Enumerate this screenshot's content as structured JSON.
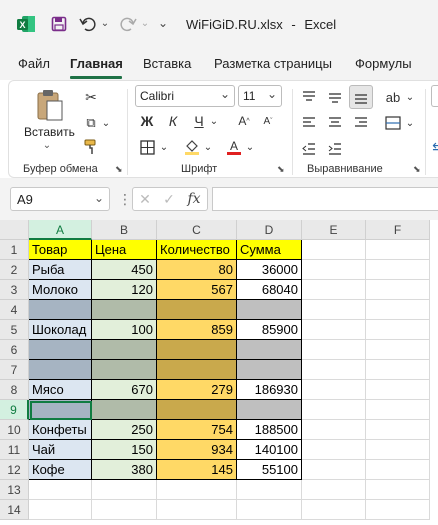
{
  "titlebar": {
    "file_name": "WiFiGiD.RU.xlsx",
    "separator": "-",
    "app_name": "Excel"
  },
  "menu": {
    "items": [
      "Файл",
      "Главная",
      "Вставка",
      "Разметка страницы",
      "Формулы"
    ],
    "active": "Главная"
  },
  "ribbon": {
    "clipboard": {
      "paste_label": "Вставить",
      "group_label": "Буфер обмена"
    },
    "font": {
      "font_name": "Calibri",
      "font_size": "11",
      "bold": "Ж",
      "italic": "К",
      "underline": "Ч",
      "group_label": "Шрифт"
    },
    "alignment": {
      "group_label": "Выравнивание"
    }
  },
  "formula_bar": {
    "cell_ref": "A9",
    "fx": "fx",
    "formula": ""
  },
  "sheet": {
    "columns": [
      "A",
      "B",
      "C",
      "D",
      "E",
      "F"
    ],
    "selected_column": "A",
    "selected_row": "9",
    "rows": [
      {
        "num": "1",
        "cells": [
          "Товар",
          "Цена",
          "Количество",
          "Сумма",
          "",
          ""
        ]
      },
      {
        "num": "2",
        "cells": [
          "Рыба",
          "450",
          "80",
          "36000",
          "",
          ""
        ]
      },
      {
        "num": "3",
        "cells": [
          "Молоко",
          "120",
          "567",
          "68040",
          "",
          ""
        ]
      },
      {
        "num": "4",
        "cells": [
          "",
          "",
          "",
          "",
          "",
          ""
        ]
      },
      {
        "num": "5",
        "cells": [
          "Шоколад",
          "100",
          "859",
          "85900",
          "",
          ""
        ]
      },
      {
        "num": "6",
        "cells": [
          "",
          "",
          "",
          "",
          "",
          ""
        ]
      },
      {
        "num": "7",
        "cells": [
          "",
          "",
          "",
          "",
          "",
          ""
        ]
      },
      {
        "num": "8",
        "cells": [
          "Мясо",
          "670",
          "279",
          "186930",
          "",
          ""
        ]
      },
      {
        "num": "9",
        "cells": [
          "",
          "",
          "",
          "",
          "",
          ""
        ]
      },
      {
        "num": "10",
        "cells": [
          "Конфеты",
          "250",
          "754",
          "188500",
          "",
          ""
        ]
      },
      {
        "num": "11",
        "cells": [
          "Чай",
          "150",
          "934",
          "140100",
          "",
          ""
        ]
      },
      {
        "num": "12",
        "cells": [
          "Кофе",
          "380",
          "145",
          "55100",
          "",
          ""
        ]
      },
      {
        "num": "13",
        "cells": [
          "",
          "",
          "",
          "",
          "",
          ""
        ]
      },
      {
        "num": "14",
        "cells": [
          "",
          "",
          "",
          "",
          "",
          ""
        ]
      }
    ],
    "colors": {
      "header_fill": "#ffff00",
      "col_a_fill": "#dce6f1",
      "col_b_fill": "#e2efda",
      "col_c_fill": "#ffd966",
      "blank_a_fill": "#a6b4c2",
      "blank_b_fill": "#b0bba9",
      "blank_c_fill": "#c9a94c",
      "blank_d_fill": "#bfbfbf",
      "selection": "#107c41"
    }
  },
  "icons": {
    "app": "excel-logo-icon",
    "save": "save-icon",
    "undo": "undo-icon",
    "redo": "redo-icon"
  }
}
